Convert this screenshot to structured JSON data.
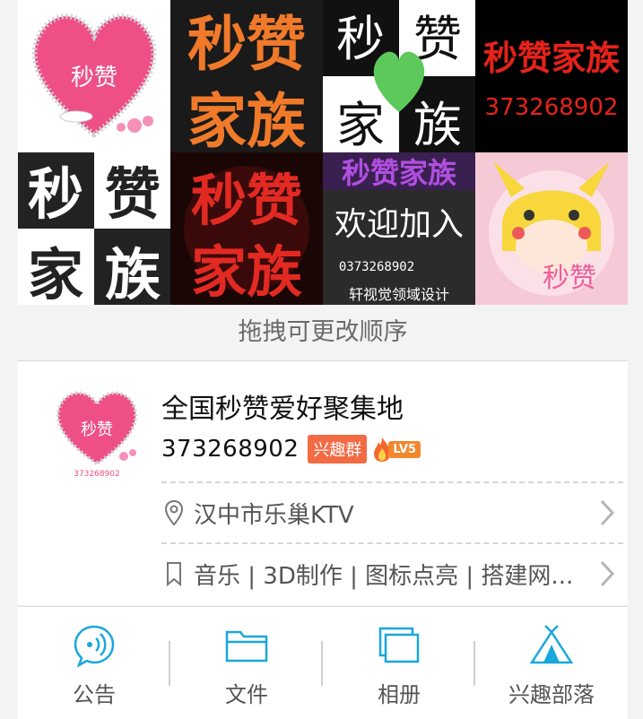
{
  "photos": {
    "tiles": [
      {
        "name": "heart-logo",
        "lines": [
          "秒赞"
        ]
      },
      {
        "name": "orange-text",
        "lines": [
          "秒赞",
          "家族"
        ]
      },
      {
        "name": "green-heart",
        "lines": [
          "秒",
          "赞",
          "家",
          "族"
        ]
      },
      {
        "name": "red-text",
        "lines": [
          "秒赞家族",
          "373268902"
        ]
      },
      {
        "name": "bw-text",
        "lines": [
          "秒",
          "赞",
          "家",
          "族"
        ]
      },
      {
        "name": "red-black-text",
        "lines": [
          "秒赞",
          "家族"
        ]
      },
      {
        "name": "purple-text",
        "lines": [
          "秒赞家族",
          "欢迎加入",
          "0373268902",
          "轩视觉领域设计"
        ]
      },
      {
        "name": "pikachu",
        "lines": [
          "秒赞"
        ]
      }
    ]
  },
  "drag_hint": "拖拽可更改顺序",
  "group": {
    "avatar_text": "秒赞",
    "avatar_number": "373268902",
    "name": "全国秒赞爱好聚集地",
    "id": "373268902",
    "tag": "兴趣群",
    "level": "LV5",
    "location": "汉中市乐巢KTV",
    "interests": "音乐 | 3D制作 | 图标点亮 | 搭建网..."
  },
  "toolbar": {
    "items": [
      {
        "label": "公告",
        "icon": "announcement-icon"
      },
      {
        "label": "文件",
        "icon": "folder-icon"
      },
      {
        "label": "相册",
        "icon": "album-icon"
      },
      {
        "label": "兴趣部落",
        "icon": "tribe-tent-icon"
      }
    ]
  },
  "colors": {
    "accent": "#1aa7dc",
    "tag": "#f26b44",
    "level": "#f2872d"
  }
}
